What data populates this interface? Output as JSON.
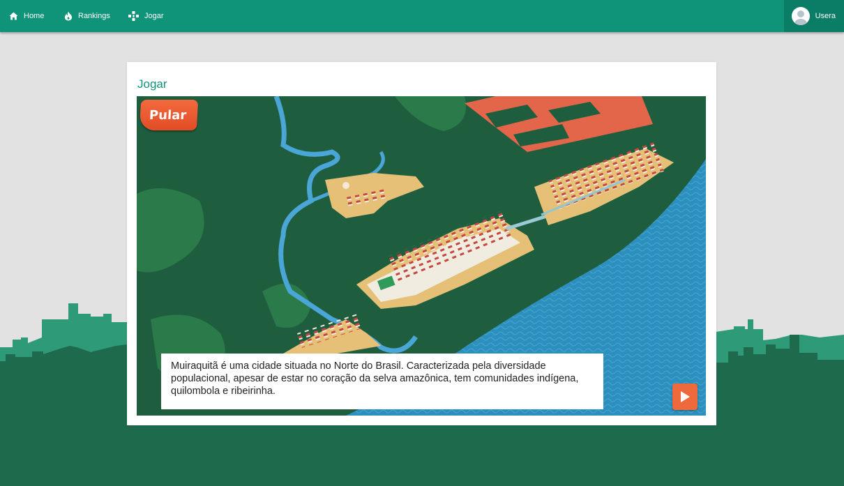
{
  "nav": {
    "items": [
      {
        "label": "Home",
        "icon": "home-icon"
      },
      {
        "label": "Rankings",
        "icon": "fire-icon"
      },
      {
        "label": "Jogar",
        "icon": "gamepad-icon"
      }
    ],
    "user": {
      "name": "Usera",
      "icon": "avatar-icon"
    }
  },
  "card": {
    "title": "Jogar"
  },
  "game": {
    "skip_label": "Pular",
    "dialog_text": "Muiraquitã é uma cidade situada no Norte do Brasil. Caracterizada pela diversidade populacional, apesar de estar no coração da selva amazônica, tem comunidades indígena, quilombola e ribeirinha.",
    "next_icon": "play-icon"
  },
  "colors": {
    "topbar": "#0f9479",
    "accent": "#12917a",
    "skip_button": "#e9552d",
    "next_button": "#ee6a3c",
    "background": "#e2e2e2"
  }
}
